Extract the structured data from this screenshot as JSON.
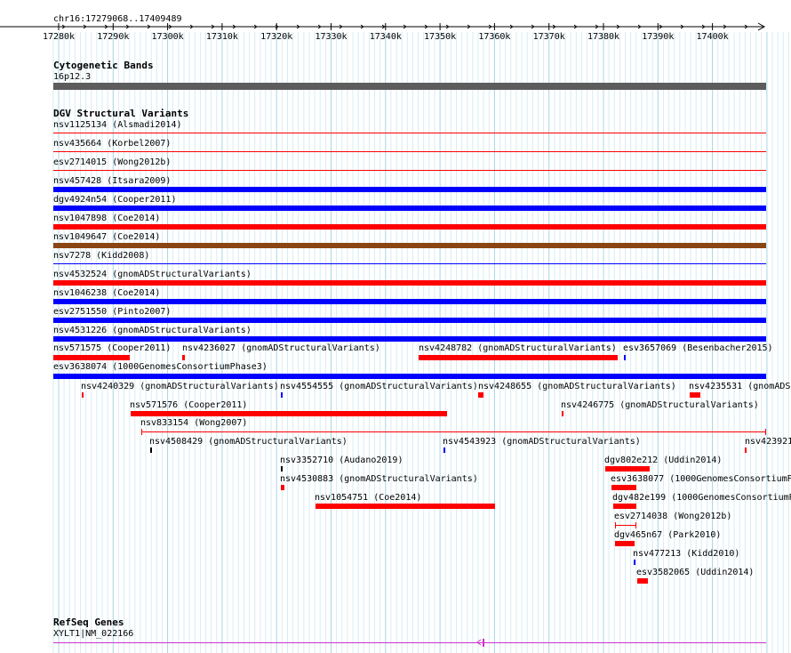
{
  "ruler": {
    "location": "chr16:17279068..17409489",
    "ticks": [
      "17280k",
      "17290k",
      "17300k",
      "17310k",
      "17320k",
      "17330k",
      "17340k",
      "17350k",
      "17360k",
      "17370k",
      "17380k",
      "17390k",
      "17400k"
    ]
  },
  "tracks": {
    "cytoband": {
      "title": "Cytogenetic Bands",
      "band_label": "16p12.3",
      "band_color": "#5c5c5c"
    },
    "dgv": {
      "title": "DGV Structural Variants",
      "colors": {
        "loss": "#ff0000",
        "gain": "#0000ff",
        "gain_loss": "#8b4513",
        "other": "#000000"
      },
      "features": [
        {
          "label": "nsv1125134 (Alsmadi2014)",
          "type": "loss",
          "style": "thin"
        },
        {
          "label": "nsv435664 (Korbel2007)",
          "type": "loss",
          "style": "thin"
        },
        {
          "label": "esv2714015 (Wong2012b)",
          "type": "loss",
          "style": "thin"
        },
        {
          "label": "nsv457428 (Itsara2009)",
          "type": "gain",
          "style": "thick"
        },
        {
          "label": "dgv4924n54 (Cooper2011)",
          "type": "gain",
          "style": "thick"
        },
        {
          "label": "nsv1047898 (Coe2014)",
          "type": "loss",
          "style": "thick"
        },
        {
          "label": "nsv1049647 (Coe2014)",
          "type": "gain_loss",
          "style": "thick"
        },
        {
          "label": "nsv7278 (Kidd2008)",
          "type": "gain",
          "style": "thin"
        },
        {
          "label": "nsv4532524 (gnomADStructuralVariants)",
          "type": "loss",
          "style": "thick"
        },
        {
          "label": "nsv1046238 (Coe2014)",
          "type": "gain",
          "style": "thick"
        },
        {
          "label": "esv2751550 (Pinto2007)",
          "type": "gain",
          "style": "thick"
        },
        {
          "label": "nsv4531226 (gnomADStructuralVariants)",
          "type": "gain",
          "style": "thick"
        },
        {
          "label": "nsv571575 (Cooper2011)",
          "type": "loss",
          "style": "thick"
        },
        {
          "label": "nsv4236027 (gnomADStructuralVariants)",
          "type": "loss",
          "style": "thick"
        },
        {
          "label": "nsv4248782 (gnomADStructuralVariants)",
          "type": "loss",
          "style": "thick"
        },
        {
          "label": "esv3657069 (Besenbacher2015)",
          "type": "gain",
          "style": "thick"
        },
        {
          "label": "esv3638074 (1000GenomesConsortiumPhase3)",
          "type": "gain",
          "style": "thick"
        },
        {
          "label": "nsv4240329 (gnomADStructuralVariants)",
          "type": "loss",
          "style": "thick"
        },
        {
          "label": "nsv4554555 (gnomADStructuralVariants)",
          "type": "gain",
          "style": "thick"
        },
        {
          "label": "nsv4248655 (gnomADStructuralVariants)",
          "type": "loss",
          "style": "thick"
        },
        {
          "label": "nsv4235531 (gnomADS",
          "type": "loss",
          "style": "thick"
        },
        {
          "label": "nsv571576 (Cooper2011)",
          "type": "loss",
          "style": "thick"
        },
        {
          "label": "nsv4246775 (gnomADStructuralVariants)",
          "type": "loss",
          "style": "thick"
        },
        {
          "label": "nsv833154 (Wong2007)",
          "type": "loss",
          "style": "thin"
        },
        {
          "label": "nsv4508429 (gnomADStructuralVariants)",
          "type": "other",
          "style": "thick"
        },
        {
          "label": "nsv4543923 (gnomADStructuralVariants)",
          "type": "gain",
          "style": "thick"
        },
        {
          "label": "nsv423921",
          "type": "loss",
          "style": "thick"
        },
        {
          "label": "nsv3352710 (Audano2019)",
          "type": "other",
          "style": "thick"
        },
        {
          "label": "dgv802e212 (Uddin2014)",
          "type": "loss",
          "style": "thick"
        },
        {
          "label": "nsv4530883 (gnomADStructuralVariants)",
          "type": "loss",
          "style": "thick"
        },
        {
          "label": "esv3638077 (1000GenomesConsortiumP",
          "type": "loss",
          "style": "thick"
        },
        {
          "label": "nsv1054751 (Coe2014)",
          "type": "loss",
          "style": "thick"
        },
        {
          "label": "dgv482e199 (1000GenomesConsortiumPi",
          "type": "loss",
          "style": "thick"
        },
        {
          "label": "esv2714038 (Wong2012b)",
          "type": "loss",
          "style": "thin"
        },
        {
          "label": "dgv465n67 (Park2010)",
          "type": "loss",
          "style": "thick"
        },
        {
          "label": "nsv477213 (Kidd2010)",
          "type": "gain",
          "style": "thick"
        },
        {
          "label": "esv3582065 (Uddin2014)",
          "type": "loss",
          "style": "thick"
        }
      ]
    },
    "refseq": {
      "title": "RefSeq Genes",
      "gene_label": "XYLT1|NM_022166",
      "color": "#cc33cc"
    }
  }
}
